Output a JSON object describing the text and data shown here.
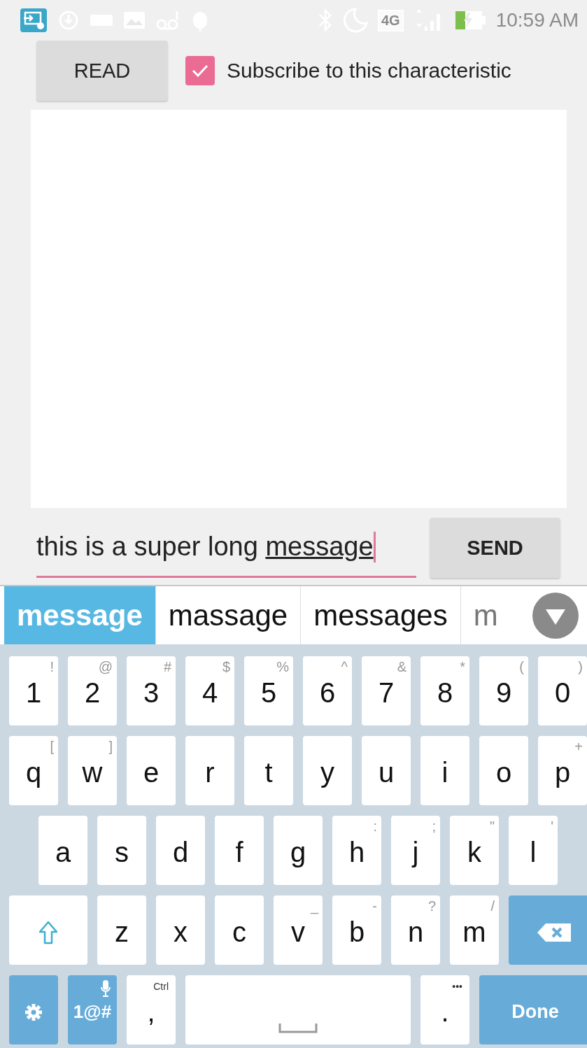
{
  "status_bar": {
    "network": "4G",
    "time": "10:59 AM"
  },
  "read_button": {
    "label": "READ"
  },
  "subscribe": {
    "label": "Subscribe to this characteristic",
    "checked": true
  },
  "message_input": {
    "value": "this is a super long ",
    "composing": "message"
  },
  "send_button": {
    "label": "SEND"
  },
  "suggestions": [
    {
      "text": "message",
      "selected": true
    },
    {
      "text": "massage",
      "selected": false
    },
    {
      "text": "messages",
      "selected": false
    },
    {
      "text": "m",
      "selected": false
    }
  ],
  "keyboard": {
    "rows": [
      [
        {
          "kind": "char",
          "label": "1",
          "alt": "!"
        },
        {
          "kind": "char",
          "label": "2",
          "alt": "@"
        },
        {
          "kind": "char",
          "label": "3",
          "alt": "#"
        },
        {
          "kind": "char",
          "label": "4",
          "alt": "$"
        },
        {
          "kind": "char",
          "label": "5",
          "alt": "%"
        },
        {
          "kind": "char",
          "label": "6",
          "alt": "^"
        },
        {
          "kind": "char",
          "label": "7",
          "alt": "&"
        },
        {
          "kind": "char",
          "label": "8",
          "alt": "*"
        },
        {
          "kind": "char",
          "label": "9",
          "alt": "("
        },
        {
          "kind": "char",
          "label": "0",
          "alt": ")"
        }
      ],
      [
        {
          "kind": "char",
          "label": "q",
          "alt": "["
        },
        {
          "kind": "char",
          "label": "w",
          "alt": "]"
        },
        {
          "kind": "char",
          "label": "e"
        },
        {
          "kind": "char",
          "label": "r"
        },
        {
          "kind": "char",
          "label": "t"
        },
        {
          "kind": "char",
          "label": "y"
        },
        {
          "kind": "char",
          "label": "u"
        },
        {
          "kind": "char",
          "label": "i"
        },
        {
          "kind": "char",
          "label": "o"
        },
        {
          "kind": "char",
          "label": "p",
          "alt": "+"
        }
      ],
      [
        {
          "kind": "char",
          "label": "a"
        },
        {
          "kind": "char",
          "label": "s"
        },
        {
          "kind": "char",
          "label": "d"
        },
        {
          "kind": "char",
          "label": "f"
        },
        {
          "kind": "char",
          "label": "g"
        },
        {
          "kind": "char",
          "label": "h",
          "alt": ":"
        },
        {
          "kind": "char",
          "label": "j",
          "alt": ";"
        },
        {
          "kind": "char",
          "label": "k",
          "alt": "\""
        },
        {
          "kind": "char",
          "label": "l",
          "alt": "'"
        }
      ],
      [
        {
          "kind": "shift"
        },
        {
          "kind": "char",
          "label": "z"
        },
        {
          "kind": "char",
          "label": "x"
        },
        {
          "kind": "char",
          "label": "c"
        },
        {
          "kind": "char",
          "label": "v",
          "alt": "_"
        },
        {
          "kind": "char",
          "label": "b",
          "alt": "-"
        },
        {
          "kind": "char",
          "label": "n",
          "alt": "?"
        },
        {
          "kind": "char",
          "label": "m",
          "alt": "/"
        },
        {
          "kind": "backspace"
        }
      ],
      [
        {
          "kind": "settings"
        },
        {
          "kind": "symbols",
          "label": "1@#"
        },
        {
          "kind": "char",
          "label": ",",
          "alt": "Ctrl"
        },
        {
          "kind": "space"
        },
        {
          "kind": "char",
          "label": ".",
          "alt": "•••"
        },
        {
          "kind": "done",
          "label": "Done"
        }
      ]
    ]
  }
}
